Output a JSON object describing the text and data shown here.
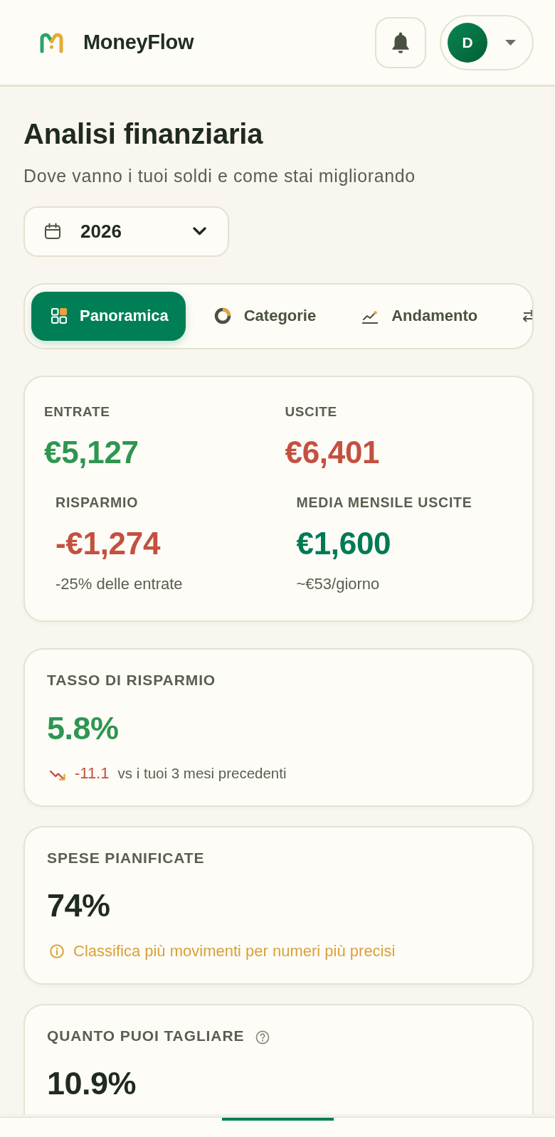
{
  "header": {
    "app_name": "MoneyFlow",
    "user_initial": "D"
  },
  "page": {
    "title": "Analisi finanziaria",
    "subtitle": "Dove vanno i tuoi soldi e come stai migliorando"
  },
  "period_select": {
    "value": "2026"
  },
  "tabs": [
    {
      "label": "Panoramica",
      "selected": true
    },
    {
      "label": "Categorie",
      "selected": false
    },
    {
      "label": "Andamento",
      "selected": false
    },
    {
      "selected": false
    }
  ],
  "summary": {
    "primary": [
      {
        "label": "ENTRATE",
        "value": "€5,127",
        "color": "#2e9650"
      },
      {
        "label": "USCITE",
        "value": "€6,401",
        "color": "#c4503f"
      }
    ],
    "secondary": [
      {
        "label": "RISPARMIO",
        "value": "-€1,274",
        "color": "#c4503f",
        "note": "-25% delle entrate"
      },
      {
        "label": "MEDIA MENSILE USCITE",
        "value": "€1,600",
        "color": "#007a55",
        "note": "~€53/giorno"
      }
    ]
  },
  "metrics": [
    {
      "label": "TASSO DI RISPARMIO",
      "value": "5.8%",
      "color": "#2e9650",
      "trend": {
        "kind": "down",
        "delta": "-11.1",
        "text": "vs i tuoi 3 mesi precedenti"
      }
    },
    {
      "label": "SPESE PIANIFICATE",
      "value": "74%",
      "color": "#1f2a20",
      "hint": "Classifica più movimenti per numeri più precisi"
    },
    {
      "label": "QUANTO PUOI TAGLIARE",
      "value": "10.9%",
      "color": "#1f2a20",
      "help": true
    }
  ]
}
